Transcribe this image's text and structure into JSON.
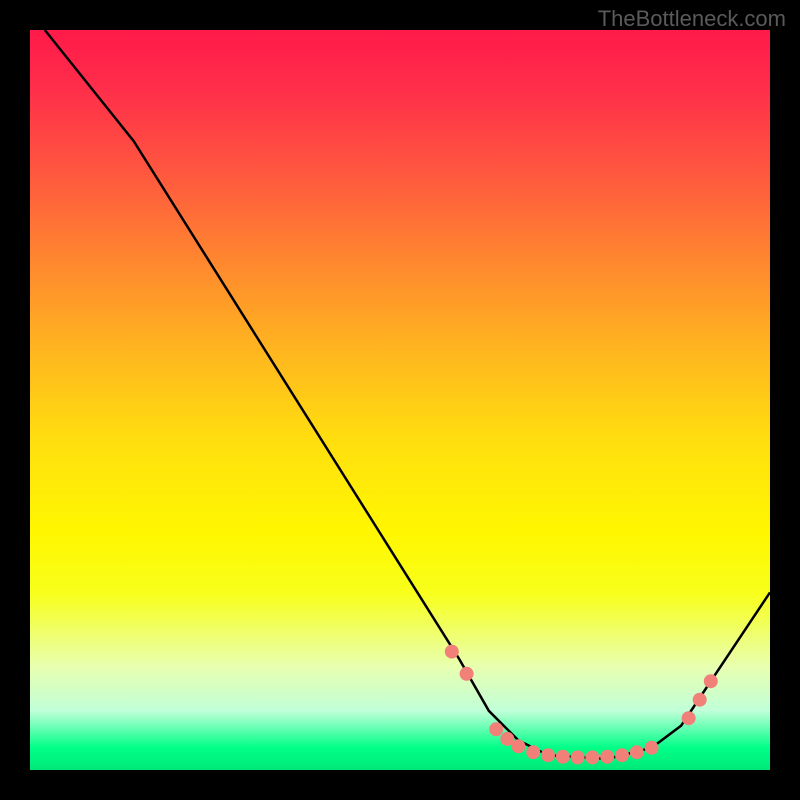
{
  "watermark": "TheBottleneck.com",
  "chart_data": {
    "type": "line",
    "title": "",
    "xlabel": "",
    "ylabel": "",
    "xlim": [
      0,
      100
    ],
    "ylim": [
      0,
      100
    ],
    "curve_points": [
      {
        "x": 2,
        "y": 100
      },
      {
        "x": 10,
        "y": 90
      },
      {
        "x": 14,
        "y": 85
      },
      {
        "x": 58,
        "y": 15
      },
      {
        "x": 62,
        "y": 8
      },
      {
        "x": 66,
        "y": 4
      },
      {
        "x": 70,
        "y": 2
      },
      {
        "x": 78,
        "y": 1.5
      },
      {
        "x": 84,
        "y": 3
      },
      {
        "x": 88,
        "y": 6
      },
      {
        "x": 100,
        "y": 24
      }
    ],
    "markers": [
      {
        "x": 57,
        "y": 16
      },
      {
        "x": 59,
        "y": 13
      },
      {
        "x": 63,
        "y": 5.5
      },
      {
        "x": 64.5,
        "y": 4.2
      },
      {
        "x": 66,
        "y": 3.2
      },
      {
        "x": 68,
        "y": 2.4
      },
      {
        "x": 70,
        "y": 2
      },
      {
        "x": 72,
        "y": 1.8
      },
      {
        "x": 74,
        "y": 1.7
      },
      {
        "x": 76,
        "y": 1.7
      },
      {
        "x": 78,
        "y": 1.8
      },
      {
        "x": 80,
        "y": 2
      },
      {
        "x": 82,
        "y": 2.4
      },
      {
        "x": 84,
        "y": 3
      },
      {
        "x": 89,
        "y": 7
      },
      {
        "x": 90.5,
        "y": 9.5
      },
      {
        "x": 92,
        "y": 12
      }
    ],
    "gradient_colors": {
      "top": "#ff1a4a",
      "mid_upper": "#ff8a2e",
      "mid": "#fff700",
      "mid_lower": "#e8ffb0",
      "bottom": "#00e878"
    }
  }
}
